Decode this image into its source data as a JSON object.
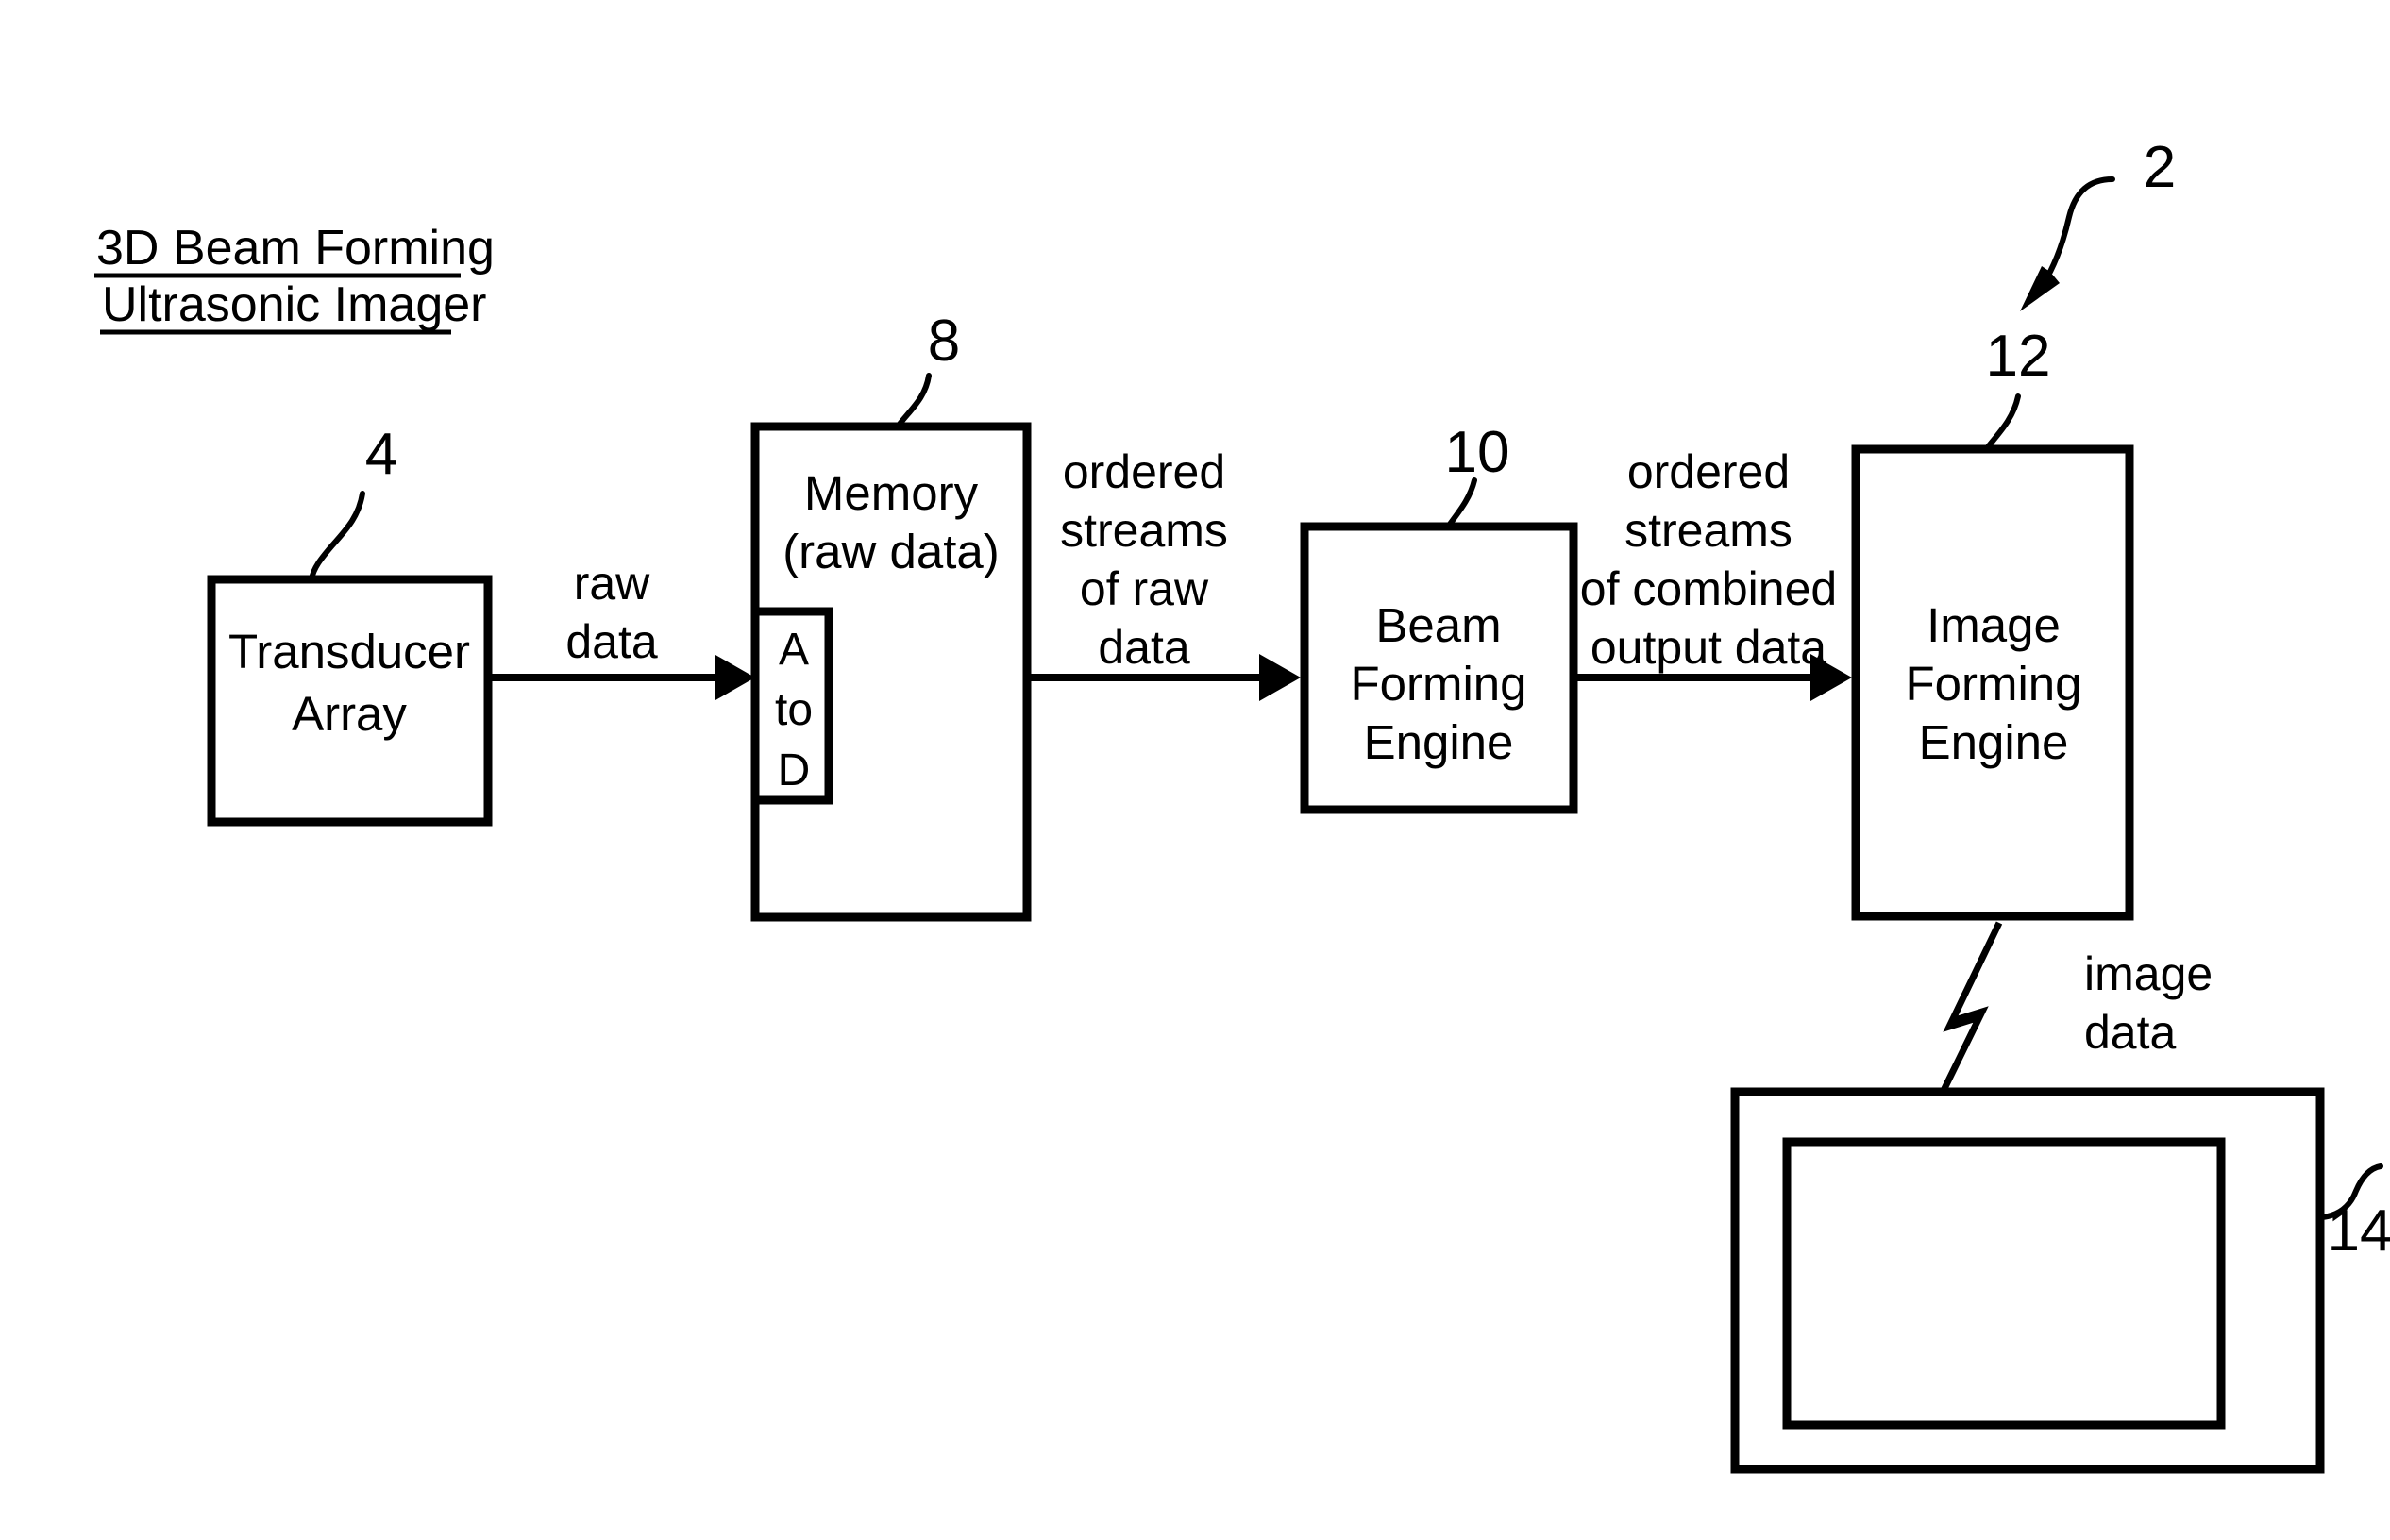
{
  "figure": {
    "title": {
      "line1": "3D Beam Forming",
      "line2": "Ultrasonic Imager"
    },
    "system_ref": "2",
    "blocks": [
      {
        "id": "transducer-array",
        "ref": "4",
        "lines": [
          "Transducer",
          "Array"
        ]
      },
      {
        "id": "memory",
        "ref": "8",
        "lines": [
          "Memory",
          "(raw data)"
        ],
        "sub_block": {
          "id": "a-to-d",
          "lines": [
            "A",
            "to",
            "D"
          ]
        }
      },
      {
        "id": "beam-forming-engine",
        "ref": "10",
        "lines": [
          "Beam",
          "Forming",
          "Engine"
        ]
      },
      {
        "id": "image-forming-engine",
        "ref": "12",
        "lines": [
          "Image",
          "Forming",
          "Engine"
        ]
      },
      {
        "id": "display",
        "ref": "14",
        "lines": []
      }
    ],
    "flows": [
      {
        "id": "raw-data",
        "from": "transducer-array",
        "to": "memory",
        "lines": [
          "raw",
          "data"
        ]
      },
      {
        "id": "ordered-streams-raw-data",
        "from": "memory",
        "to": "beam-forming-engine",
        "lines": [
          "ordered",
          "streams",
          "of raw",
          "data"
        ]
      },
      {
        "id": "ordered-streams-combined-output-data",
        "from": "beam-forming-engine",
        "to": "image-forming-engine",
        "lines": [
          "ordered",
          "streams",
          "of combined",
          "output data"
        ]
      },
      {
        "id": "image-data",
        "from": "image-forming-engine",
        "to": "display",
        "lines": [
          "image",
          "data"
        ],
        "icon": "lightning-bolt-icon"
      }
    ],
    "colors": {
      "ink": "#000000",
      "paper": "#ffffff"
    }
  }
}
